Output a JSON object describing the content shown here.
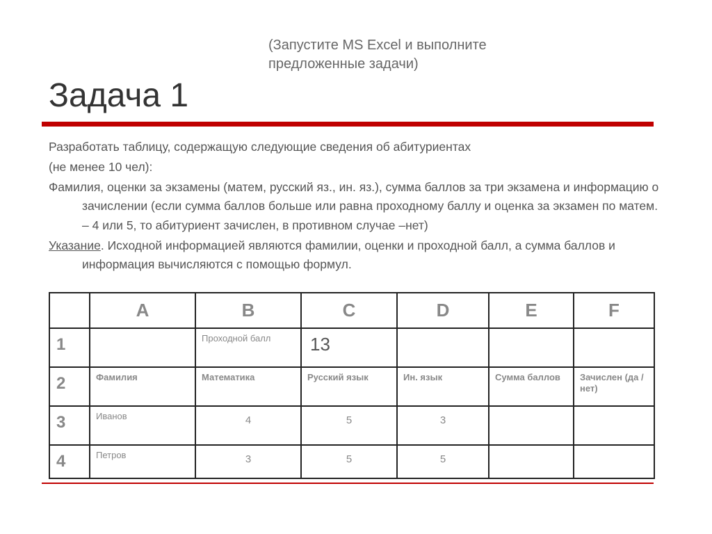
{
  "subtitle_line1": "(Запустите MS Excel и выполните",
  "subtitle_line2": "предложенные задачи)",
  "title": "Задача 1",
  "paragraphs": {
    "p1": "Разработать таблицу, содержащую следующие сведения об абитуриентах",
    "p2": "(не менее 10 чел):",
    "p3": "Фамилия, оценки за экзамены (матем, русский яз., ин. яз.), сумма баллов за три экзамена и информацию о зачислении (если сумма баллов больше или равна проходному баллу и оценка за экзамен по матем. – 4 или 5, то абитуриент зачислен, в противном случае –нет)",
    "p4_label": "Указание",
    "p4_rest": ". Исходной информацией являются фамилии, оценки и проходной балл, а сумма баллов и информация вычисляются с помощью формул."
  },
  "columns": [
    "A",
    "B",
    "C",
    "D",
    "E",
    "F"
  ],
  "rows": [
    "1",
    "2",
    "3",
    "4"
  ],
  "cells": {
    "r1": {
      "A": "",
      "B": "Проходной балл",
      "C": "13",
      "D": "",
      "E": "",
      "F": ""
    },
    "r2": {
      "A": "Фамилия",
      "B": "Математика",
      "C": "Русский язык",
      "D": "Ин. язык",
      "E": "Сумма баллов",
      "F": "Зачислен (да /нет)"
    },
    "r3": {
      "A": "Иванов",
      "B": "4",
      "C": "5",
      "D": "3",
      "E": "",
      "F": ""
    },
    "r4": {
      "A": "Петров",
      "B": "3",
      "C": "5",
      "D": "5",
      "E": "",
      "F": ""
    }
  },
  "chart_data": {
    "type": "table",
    "title": "Задача 1 — таблица абитуриентов",
    "columns": [
      "",
      "A",
      "B",
      "C",
      "D",
      "E",
      "F"
    ],
    "rows": [
      [
        "1",
        "",
        "Проходной балл",
        "13",
        "",
        "",
        ""
      ],
      [
        "2",
        "Фамилия",
        "Математика",
        "Русский язык",
        "Ин. язык",
        "Сумма баллов",
        "Зачислен (да /нет)"
      ],
      [
        "3",
        "Иванов",
        4,
        5,
        3,
        "",
        ""
      ],
      [
        "4",
        "Петров",
        3,
        5,
        5,
        "",
        ""
      ]
    ]
  }
}
